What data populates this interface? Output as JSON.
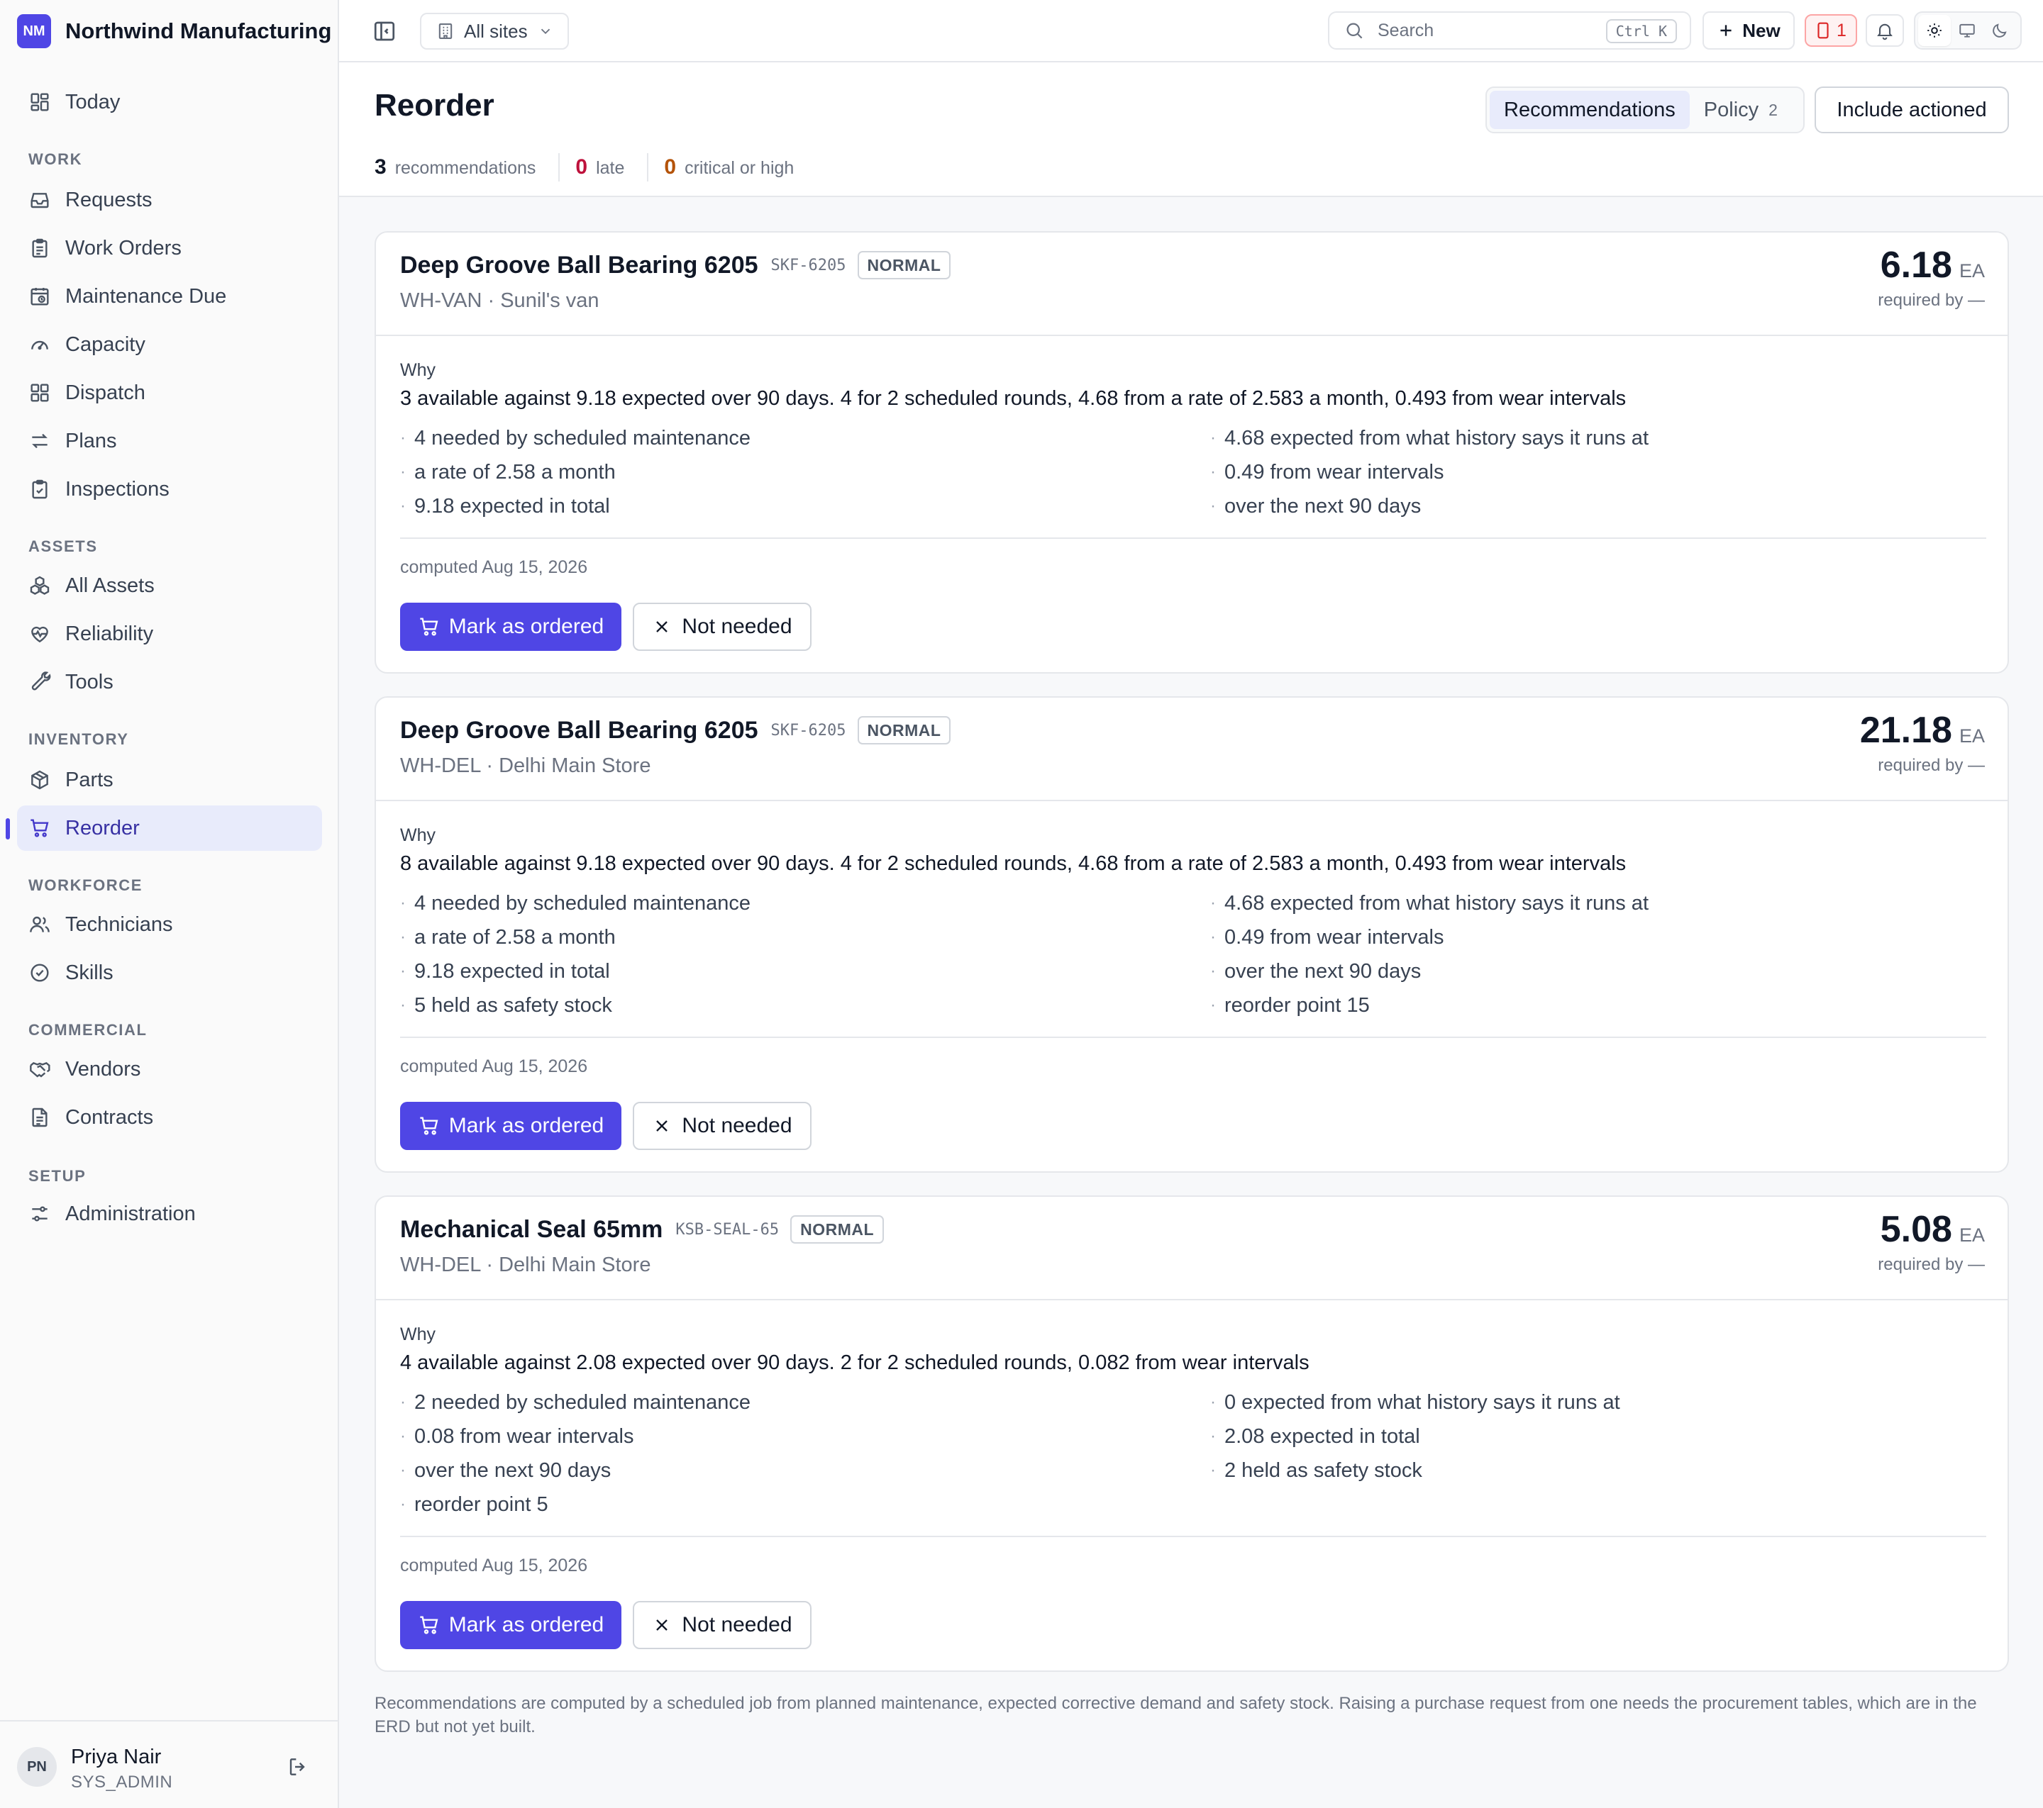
{
  "app": {
    "initials": "NM",
    "name": "Northwind Manufacturing"
  },
  "sidebar": {
    "today": "Today",
    "sections": {
      "work": "WORK",
      "assets": "ASSETS",
      "inventory": "INVENTORY",
      "workforce": "WORKFORCE",
      "commercial": "COMMERCIAL",
      "setup": "SETUP"
    },
    "items": {
      "requests": "Requests",
      "work_orders": "Work Orders",
      "maintenance_due": "Maintenance Due",
      "capacity": "Capacity",
      "dispatch": "Dispatch",
      "plans": "Plans",
      "inspections": "Inspections",
      "all_assets": "All Assets",
      "reliability": "Reliability",
      "tools": "Tools",
      "parts": "Parts",
      "reorder": "Reorder",
      "technicians": "Technicians",
      "skills": "Skills",
      "vendors": "Vendors",
      "contracts": "Contracts",
      "administration": "Administration"
    },
    "active": "reorder"
  },
  "user": {
    "initials": "PN",
    "name": "Priya Nair",
    "role": "SYS_ADMIN"
  },
  "topbar": {
    "site": "All sites",
    "search_placeholder": "Search",
    "shortcut": "Ctrl K",
    "new_label": "New",
    "alert_count": "1",
    "theme_active": "light"
  },
  "header": {
    "title": "Reorder",
    "stats": [
      {
        "value": "3",
        "label": "recommendations",
        "tone": "default"
      },
      {
        "value": "0",
        "label": "late",
        "tone": "late"
      },
      {
        "value": "0",
        "label": "critical or high",
        "tone": "crit"
      }
    ],
    "tabs": [
      {
        "label": "Recommendations",
        "badge": "",
        "active": true
      },
      {
        "label": "Policy",
        "badge": "2",
        "active": false
      }
    ],
    "include_actioned": "Include actioned"
  },
  "labels": {
    "why": "Why",
    "mark_ordered": "Mark as ordered",
    "not_needed": "Not needed"
  },
  "cards": [
    {
      "part": "Deep Groove Ball Bearing 6205",
      "sku": "SKF-6205",
      "priority": "NORMAL",
      "location": "WH-VAN · Sunil's van",
      "qty": "6.18",
      "unit": "EA",
      "required_by": "required by —",
      "why": "3 available against 9.18 expected over 90 days. 4 for 2 scheduled rounds, 4.68 from a rate of 2.583 a month, 0.493 from wear intervals",
      "bullets": [
        "4 needed by scheduled maintenance",
        "4.68 expected from what history says it runs at",
        "a rate of 2.58 a month",
        "0.49 from wear intervals",
        "9.18 expected in total",
        "over the next 90 days"
      ],
      "computed": "computed Aug 15, 2026"
    },
    {
      "part": "Deep Groove Ball Bearing 6205",
      "sku": "SKF-6205",
      "priority": "NORMAL",
      "location": "WH-DEL · Delhi Main Store",
      "qty": "21.18",
      "unit": "EA",
      "required_by": "required by —",
      "why": "8 available against 9.18 expected over 90 days. 4 for 2 scheduled rounds, 4.68 from a rate of 2.583 a month, 0.493 from wear intervals",
      "bullets": [
        "4 needed by scheduled maintenance",
        "4.68 expected from what history says it runs at",
        "a rate of 2.58 a month",
        "0.49 from wear intervals",
        "9.18 expected in total",
        "over the next 90 days",
        "5 held as safety stock",
        "reorder point 15"
      ],
      "computed": "computed Aug 15, 2026"
    },
    {
      "part": "Mechanical Seal 65mm",
      "sku": "KSB-SEAL-65",
      "priority": "NORMAL",
      "location": "WH-DEL · Delhi Main Store",
      "qty": "5.08",
      "unit": "EA",
      "required_by": "required by —",
      "why": "4 available against 2.08 expected over 90 days. 2 for 2 scheduled rounds, 0.082 from wear intervals",
      "bullets": [
        "2 needed by scheduled maintenance",
        "0 expected from what history says it runs at",
        "0.08 from wear intervals",
        "2.08 expected in total",
        "over the next 90 days",
        "2 held as safety stock",
        "reorder point 5"
      ],
      "computed": "computed Aug 15, 2026"
    }
  ],
  "footer_note": "Recommendations are computed by a scheduled job from planned maintenance, expected corrective demand and safety stock. Raising a purchase request from one needs the procurement tables, which are in the ERD but not yet built."
}
